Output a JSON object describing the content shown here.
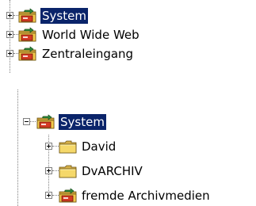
{
  "tree_top": {
    "items": [
      {
        "label": "System",
        "icon": "network-drive-icon",
        "selected": true,
        "expanded": false
      },
      {
        "label": "World Wide Web",
        "icon": "network-drive-icon",
        "selected": false,
        "expanded": false
      },
      {
        "label": "Zentraleingang",
        "icon": "network-drive-icon",
        "selected": false,
        "expanded": false
      }
    ]
  },
  "tree_bottom": {
    "root": {
      "label": "System",
      "icon": "network-drive-icon",
      "selected": true,
      "expanded": true
    },
    "children": [
      {
        "label": "David",
        "icon": "folder-icon",
        "expanded": false
      },
      {
        "label": "DvARCHIV",
        "icon": "folder-icon",
        "expanded": false
      },
      {
        "label": "fremde Archivmedien",
        "icon": "network-drive-icon",
        "expanded": false
      }
    ]
  },
  "colors": {
    "selection_bg": "#0a246a",
    "selection_fg": "#ffffff",
    "folder_yellow": "#f4d35e",
    "drive_red": "#d43a24",
    "drive_green": "#2e8b3e",
    "tree_line": "#808080"
  }
}
